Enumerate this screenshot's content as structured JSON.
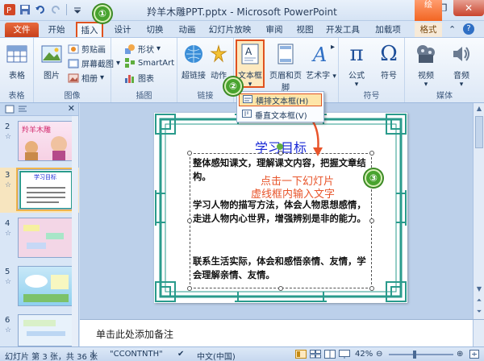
{
  "window": {
    "title": "羚羊木雕PPT.pptx - Microsoft PowerPoint",
    "controls": [
      "—",
      "❐",
      "✕"
    ]
  },
  "qat": {
    "icons": [
      "ppt-logo-icon",
      "save-icon",
      "undo-icon",
      "redo-icon",
      "customize-icon"
    ]
  },
  "tabs": {
    "file": "文件",
    "items": [
      "开始",
      "插入",
      "设计",
      "切换",
      "动画",
      "幻灯片放映",
      "审阅",
      "视图",
      "开发工具",
      "加载项",
      "格式"
    ],
    "contextual": "绘",
    "help": "?"
  },
  "ribbon": {
    "groups": {
      "table": {
        "label": "表格",
        "button": "表格"
      },
      "images": {
        "label": "图像",
        "picture": "图片",
        "clipart": "剪贴画",
        "screenshot": "屏幕截图",
        "album": "相册"
      },
      "illustrations": {
        "label": "插图",
        "shapes": "形状",
        "smartart": "SmartArt",
        "chart": "图表"
      },
      "links": {
        "label": "链接",
        "hyperlink": "超链接",
        "action": "动作"
      },
      "text": {
        "textbox": "文本框",
        "header_footer": "页眉和页脚",
        "wordart": "艺术字"
      },
      "symbols": {
        "label": "符号",
        "equation": "公式",
        "symbol": "符号"
      },
      "media": {
        "label": "媒体",
        "video": "视频",
        "audio": "音频"
      }
    }
  },
  "dropdown": {
    "items": [
      {
        "label": "横排文本框(H)",
        "highlighted": true
      },
      {
        "label": "垂直文本框(V)",
        "highlighted": false
      }
    ]
  },
  "slides": [
    {
      "num": "2",
      "title": "羚羊木雕",
      "selected": false
    },
    {
      "num": "3",
      "title": "学习目标",
      "selected": true
    },
    {
      "num": "4",
      "title": "",
      "selected": false
    },
    {
      "num": "5",
      "title": "",
      "selected": false
    },
    {
      "num": "6",
      "title": "",
      "selected": false
    }
  ],
  "slide": {
    "title": "学习目标",
    "paragraphs": [
      "整体感知课文，理解课文内容，把握文章结构。",
      "学习人物的描写方法，体会人物思想感情，走进人物内心世界，增强辨别是非的能力。",
      "联系生活实际，体会和感悟亲情、友情，学会理解亲情、友情。"
    ],
    "annotation": [
      "点击一下幻灯片",
      "虚线框内输入文字"
    ]
  },
  "steps": [
    "①",
    "②",
    "③"
  ],
  "notes": {
    "placeholder": "单击此处添加备注"
  },
  "status": {
    "slide_info": "幻灯片 第 3 张，共 36 张",
    "theme": "\"CCONTNTH\"",
    "language": "中文(中国)",
    "zoom": "42%"
  },
  "colors": {
    "accent_orange": "#e0521f",
    "title_blue": "#1a2ad6",
    "step_green": "#48a32e",
    "annotation_orange": "#e8542a"
  }
}
